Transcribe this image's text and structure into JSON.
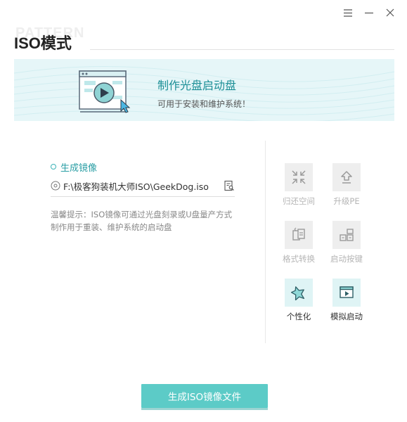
{
  "window": {
    "title": "ISO模式",
    "watermark": "PATTERN"
  },
  "banner": {
    "title": "制作光盘启动盘",
    "subtitle": "可用于安装和维护系统！"
  },
  "iso": {
    "section_label": "生成镜像",
    "path": "F:\\极客狗装机大师ISO\\GeekDog.iso",
    "tip": "温馨提示：ISO镜像可通过光盘刻录或U盘量产方式制作用于重装、维护系统的启动盘"
  },
  "tools": [
    {
      "label": "归还空间",
      "icon": "shrink-arrows-icon",
      "enabled": false
    },
    {
      "label": "升级PE",
      "icon": "upload-arrow-icon",
      "enabled": false
    },
    {
      "label": "格式转换",
      "icon": "file-convert-icon",
      "enabled": false
    },
    {
      "label": "启动按键",
      "icon": "keyboard-keys-icon",
      "enabled": false
    },
    {
      "label": "个性化",
      "icon": "star-icon",
      "enabled": true
    },
    {
      "label": "模拟启动",
      "icon": "play-window-icon",
      "enabled": true
    }
  ],
  "actions": {
    "generate_label": "生成ISO镜像文件"
  },
  "colors": {
    "accent": "#5ccbc7",
    "accent_text": "#2a9ea4",
    "banner_bg": "#e6f6f8"
  }
}
